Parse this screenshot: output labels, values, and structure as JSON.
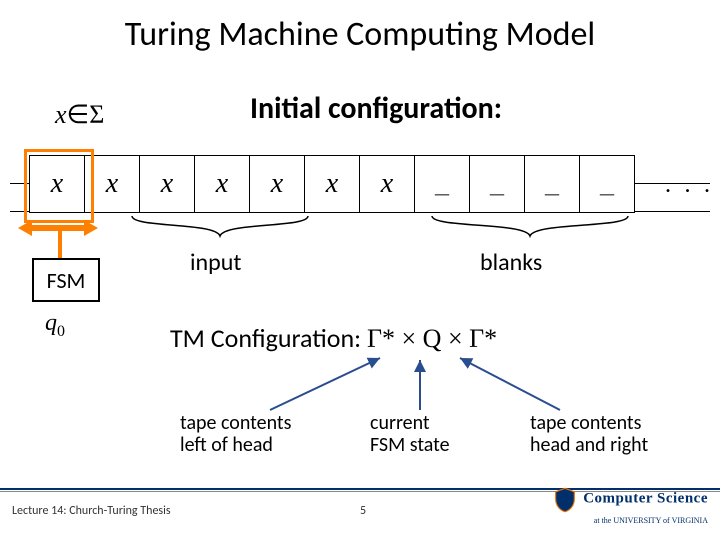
{
  "title": "Turing Machine Computing Model",
  "subtitle": "Initial configuration:",
  "sigma_label_x": "x",
  "sigma_label_rel": "∈Σ",
  "sigma_label_star": "",
  "tape": {
    "cells": [
      "x",
      "x",
      "x",
      "x",
      "x",
      "x",
      "x",
      "_",
      "_",
      "_",
      "_"
    ],
    "ellipsis": ". . ."
  },
  "fsm_label": "FSM",
  "initial_state": "q",
  "initial_state_sub": "0",
  "input_label": "input",
  "blanks_label": "blanks",
  "tm_config_prefix": "TM Configuration: ",
  "tm_config_expr": "Γ* × Q × Γ*",
  "annotations": {
    "left": "tape contents\nleft of head",
    "mid": "current\nFSM state",
    "right": "tape contents\nhead and right"
  },
  "footer": {
    "lecture": "Lecture 14: Church-Turing Thesis",
    "page": "5",
    "logo_top": "Computer Science",
    "logo_bottom": "at the UNIVERSITY of VIRGINIA"
  }
}
